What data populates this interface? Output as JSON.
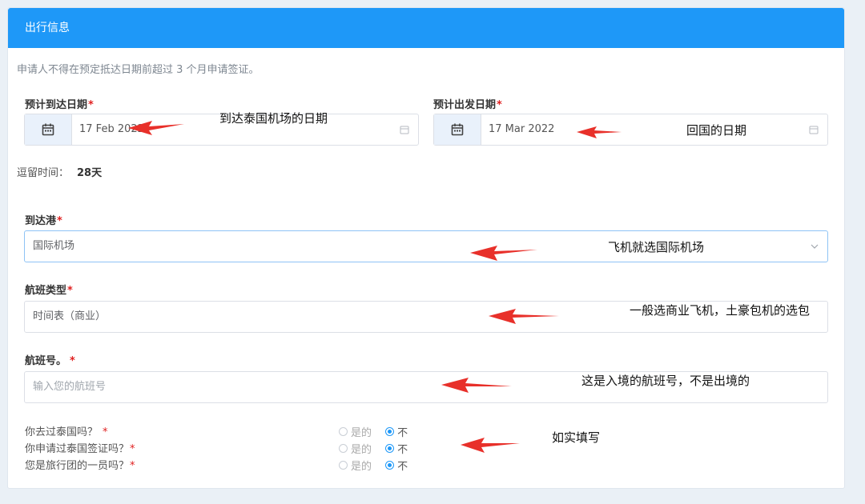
{
  "header": {
    "title": "出行信息"
  },
  "notice": "申请人不得在预定抵达日期前超过 3 个月申请签证。",
  "arrival": {
    "label": "预计到达日期",
    "required": "*",
    "value": "17 Feb 2022"
  },
  "departure": {
    "label": "预计出发日期",
    "required": "*",
    "value": "17 Mar 2022"
  },
  "stay": {
    "label": "逗留时间：",
    "value": "28天"
  },
  "port": {
    "label": "到达港",
    "required": "*",
    "value": "国际机场"
  },
  "flight_type": {
    "label": "航班类型",
    "required": "*",
    "value": "时间表（商业）"
  },
  "flight_no": {
    "label": "航班号。",
    "required": "*",
    "placeholder": "输入您的航班号"
  },
  "questions": [
    {
      "text": "你去过泰国吗？",
      "required": "*",
      "yes": "是的",
      "no": "不",
      "selected": "no"
    },
    {
      "text": "你申请过泰国签证吗？",
      "required": "*",
      "yes": "是的",
      "no": "不",
      "selected": "no"
    },
    {
      "text": "您是旅行团的一员吗？",
      "required": "*",
      "yes": "是的",
      "no": "不",
      "selected": "no"
    }
  ],
  "annotations": {
    "arrival": "到达泰国机场的日期",
    "departure": "回国的日期",
    "port": "飞机就选国际机场",
    "flight_type": "一般选商业飞机，土豪包机的选包",
    "flight_no": "这是入境的航班号，不是出境的",
    "questions": "如实填写"
  },
  "colors": {
    "header": "#1e98f8",
    "arrow": "#e8302a",
    "required": "#e02020",
    "radio_selected": "#1e98f8"
  }
}
